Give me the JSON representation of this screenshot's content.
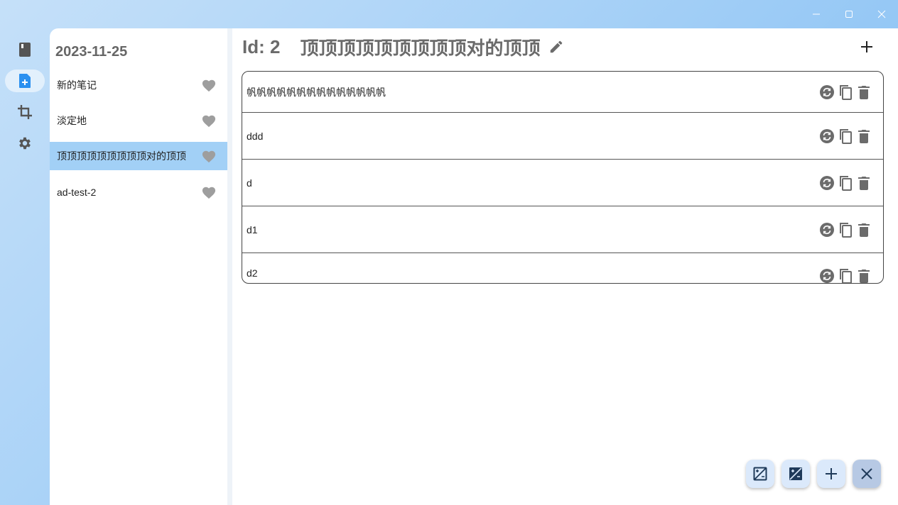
{
  "window": {
    "controls": [
      "minimize",
      "maximize",
      "close"
    ]
  },
  "rail": {
    "items": [
      {
        "icon": "book-icon",
        "active": false
      },
      {
        "icon": "note-add-icon",
        "active": true
      },
      {
        "icon": "crop-icon",
        "active": false
      },
      {
        "icon": "gear-icon",
        "active": false
      }
    ]
  },
  "list": {
    "date": "2023-11-25",
    "items": [
      {
        "label": "新的笔记",
        "selected": false
      },
      {
        "label": "淡定地",
        "selected": false
      },
      {
        "label": "顶顶顶顶顶顶顶顶顶对的顶顶",
        "selected": true
      },
      {
        "label": "ad-test-2",
        "selected": false
      }
    ]
  },
  "main": {
    "id_label": "Id: 2",
    "title": "顶顶顶顶顶顶顶顶顶对的顶顶",
    "entries": [
      {
        "text": "帆帆帆帆帆帆帆帆帆帆帆帆帆帆"
      },
      {
        "text": "ddd"
      },
      {
        "text": "d"
      },
      {
        "text": "d1"
      },
      {
        "text": "d2"
      }
    ]
  },
  "fabs": [
    {
      "icon": "image-outline-icon"
    },
    {
      "icon": "image-filled-icon"
    },
    {
      "icon": "plus-icon"
    },
    {
      "icon": "close-icon"
    }
  ],
  "colors": {
    "accent_light": "#a2d0f6",
    "icon_gray": "#6b6b6b",
    "heart_gray": "#9e9e9e",
    "rail_active_icon": "#2b90f0"
  }
}
